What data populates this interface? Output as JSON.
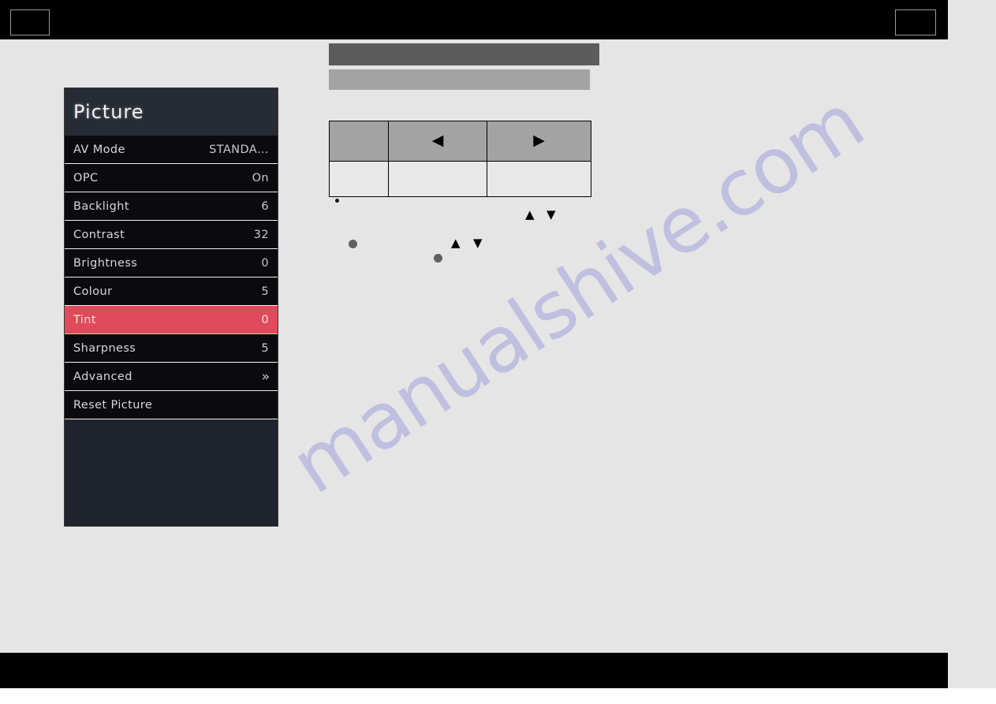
{
  "page": {
    "watermark": "manualshive.com",
    "background_color": "#e5e5e5",
    "band_color": "#000000"
  },
  "osd_menu": {
    "title": "Picture",
    "accent_color": "#e1495c",
    "rows": [
      {
        "label": "AV Mode",
        "value": "STANDA…",
        "selected": false,
        "kind": "text"
      },
      {
        "label": "OPC",
        "value": "On",
        "selected": false,
        "kind": "text"
      },
      {
        "label": "Backlight",
        "value": "6",
        "selected": false,
        "kind": "number"
      },
      {
        "label": "Contrast",
        "value": "32",
        "selected": false,
        "kind": "number"
      },
      {
        "label": "Brightness",
        "value": "0",
        "selected": false,
        "kind": "number"
      },
      {
        "label": "Colour",
        "value": "5",
        "selected": false,
        "kind": "number"
      },
      {
        "label": "Tint",
        "value": "0",
        "selected": true,
        "kind": "number"
      },
      {
        "label": "Sharpness",
        "value": "5",
        "selected": false,
        "kind": "number"
      },
      {
        "label": "Advanced",
        "value": "»",
        "selected": false,
        "kind": "submenu"
      },
      {
        "label": "Reset Picture",
        "value": "",
        "selected": false,
        "kind": "action"
      }
    ]
  },
  "nav_table": {
    "header_cells": [
      "",
      "◀",
      "▶"
    ],
    "body_cells": [
      "",
      "",
      ""
    ],
    "header_bg": "#a3a3a3",
    "body_bg": "#e8e8e8"
  },
  "redaction_bars": [
    {
      "color": "#5c5c5c"
    },
    {
      "color": "#a3a3a3"
    }
  ],
  "glyphs": {
    "up": "▲",
    "down": "▼"
  }
}
